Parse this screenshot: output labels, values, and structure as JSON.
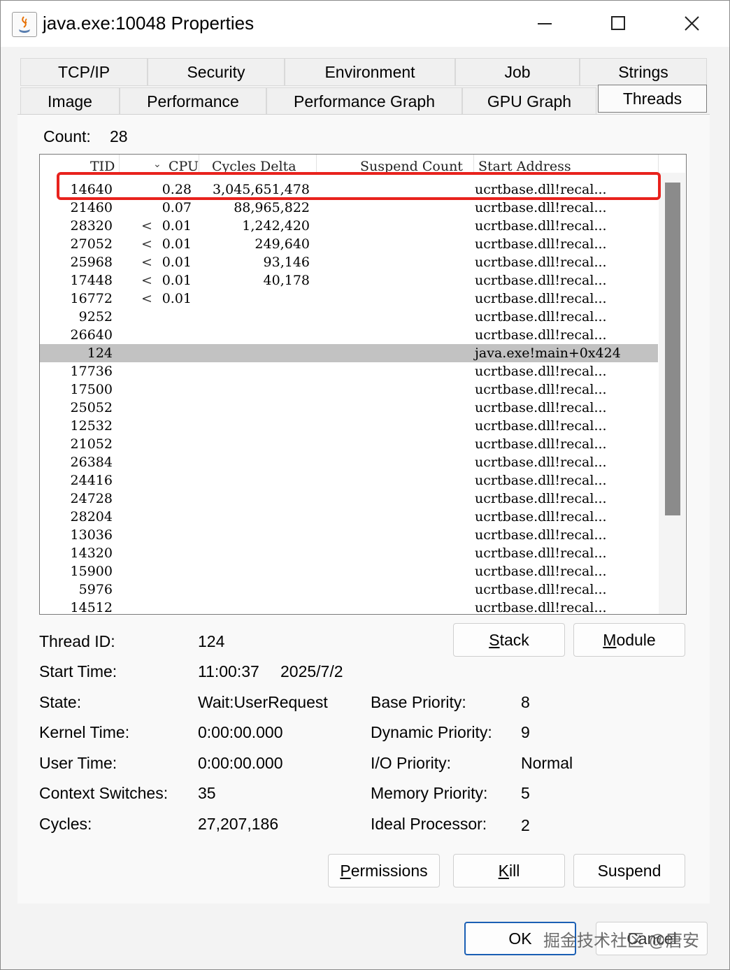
{
  "window": {
    "title": "java.exe:10048 Properties",
    "controls": {
      "minimize": "minimize",
      "maximize": "maximize",
      "close": "close"
    }
  },
  "tabs_row1": [
    "TCP/IP",
    "Security",
    "Environment",
    "Job",
    "Strings"
  ],
  "tabs_row2": [
    "Image",
    "Performance",
    "Performance Graph",
    "GPU Graph",
    "Threads"
  ],
  "active_tab": "Threads",
  "count": {
    "label": "Count:",
    "value": "28"
  },
  "columns": {
    "tid": "TID",
    "cpu": "CPU",
    "cycles": "Cycles Delta",
    "suspend": "Suspend Count",
    "start": "Start Address"
  },
  "threads": [
    {
      "tid": "14640",
      "lt": "",
      "cpu": "0.28",
      "cycles": "3,045,651,478",
      "addr": "ucrtbase.dll!recal..."
    },
    {
      "tid": "21460",
      "lt": "",
      "cpu": "0.07",
      "cycles": "88,965,822",
      "addr": "ucrtbase.dll!recal..."
    },
    {
      "tid": "28320",
      "lt": "<",
      "cpu": "0.01",
      "cycles": "1,242,420",
      "addr": "ucrtbase.dll!recal..."
    },
    {
      "tid": "27052",
      "lt": "<",
      "cpu": "0.01",
      "cycles": "249,640",
      "addr": "ucrtbase.dll!recal..."
    },
    {
      "tid": "25968",
      "lt": "<",
      "cpu": "0.01",
      "cycles": "93,146",
      "addr": "ucrtbase.dll!recal..."
    },
    {
      "tid": "17448",
      "lt": "<",
      "cpu": "0.01",
      "cycles": "40,178",
      "addr": "ucrtbase.dll!recal..."
    },
    {
      "tid": "16772",
      "lt": "<",
      "cpu": "0.01",
      "cycles": "",
      "addr": "ucrtbase.dll!recal..."
    },
    {
      "tid": "9252",
      "lt": "",
      "cpu": "",
      "cycles": "",
      "addr": "ucrtbase.dll!recal..."
    },
    {
      "tid": "26640",
      "lt": "",
      "cpu": "",
      "cycles": "",
      "addr": "ucrtbase.dll!recal..."
    },
    {
      "tid": "124",
      "lt": "",
      "cpu": "",
      "cycles": "",
      "addr": "java.exe!main+0x424",
      "selected": true
    },
    {
      "tid": "17736",
      "lt": "",
      "cpu": "",
      "cycles": "",
      "addr": "ucrtbase.dll!recal..."
    },
    {
      "tid": "17500",
      "lt": "",
      "cpu": "",
      "cycles": "",
      "addr": "ucrtbase.dll!recal..."
    },
    {
      "tid": "25052",
      "lt": "",
      "cpu": "",
      "cycles": "",
      "addr": "ucrtbase.dll!recal..."
    },
    {
      "tid": "12532",
      "lt": "",
      "cpu": "",
      "cycles": "",
      "addr": "ucrtbase.dll!recal..."
    },
    {
      "tid": "21052",
      "lt": "",
      "cpu": "",
      "cycles": "",
      "addr": "ucrtbase.dll!recal..."
    },
    {
      "tid": "26384",
      "lt": "",
      "cpu": "",
      "cycles": "",
      "addr": "ucrtbase.dll!recal..."
    },
    {
      "tid": "24416",
      "lt": "",
      "cpu": "",
      "cycles": "",
      "addr": "ucrtbase.dll!recal..."
    },
    {
      "tid": "24728",
      "lt": "",
      "cpu": "",
      "cycles": "",
      "addr": "ucrtbase.dll!recal..."
    },
    {
      "tid": "28204",
      "lt": "",
      "cpu": "",
      "cycles": "",
      "addr": "ucrtbase.dll!recal..."
    },
    {
      "tid": "13036",
      "lt": "",
      "cpu": "",
      "cycles": "",
      "addr": "ucrtbase.dll!recal..."
    },
    {
      "tid": "14320",
      "lt": "",
      "cpu": "",
      "cycles": "",
      "addr": "ucrtbase.dll!recal..."
    },
    {
      "tid": "15900",
      "lt": "",
      "cpu": "",
      "cycles": "",
      "addr": "ucrtbase.dll!recal..."
    },
    {
      "tid": "5976",
      "lt": "",
      "cpu": "",
      "cycles": "",
      "addr": "ucrtbase.dll!recal..."
    },
    {
      "tid": "14512",
      "lt": "",
      "cpu": "",
      "cycles": "",
      "addr": "ucrtbase.dll!recal..."
    }
  ],
  "details": {
    "thread_id": {
      "label": "Thread ID:",
      "value": "124"
    },
    "start_time": {
      "label": "Start Time:",
      "time": "11:00:37",
      "date": "2025/7/2"
    },
    "state": {
      "label": "State:",
      "value": "Wait:UserRequest"
    },
    "kernel_time": {
      "label": "Kernel Time:",
      "value": "0:00:00.000"
    },
    "user_time": {
      "label": "User Time:",
      "value": "0:00:00.000"
    },
    "context_switches": {
      "label": "Context Switches:",
      "value": "35"
    },
    "cycles": {
      "label": "Cycles:",
      "value": "27,207,186"
    },
    "base_priority": {
      "label": "Base Priority:",
      "value": "8"
    },
    "dynamic_priority": {
      "label": "Dynamic Priority:",
      "value": "9"
    },
    "io_priority": {
      "label": "I/O Priority:",
      "value": "Normal"
    },
    "memory_priority": {
      "label": "Memory Priority:",
      "value": "5"
    },
    "ideal_processor": {
      "label": "Ideal Processor:",
      "value": "2"
    }
  },
  "buttons": {
    "stack": {
      "u": "S",
      "rest": "tack"
    },
    "module": {
      "u": "M",
      "rest": "odule"
    },
    "permissions": {
      "u": "P",
      "rest": "ermissions"
    },
    "kill": {
      "u": "K",
      "rest": "ill"
    },
    "suspend": {
      "label": "Suspend"
    },
    "ok": {
      "label": "OK"
    },
    "cancel": {
      "label": "Cancel"
    }
  },
  "watermark": "掘金技术社区 @唐安",
  "colors": {
    "highlight_box": "#e8221d",
    "selected_row": "#c2c2c2",
    "scroll_thumb": "#8b8b8b"
  }
}
